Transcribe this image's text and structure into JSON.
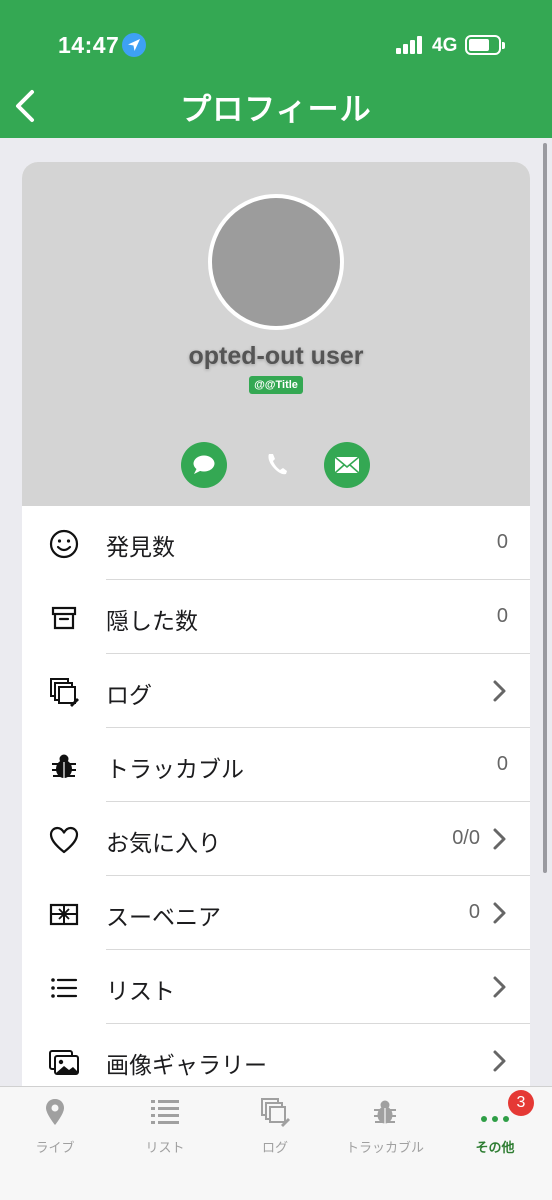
{
  "status_bar": {
    "time": "14:47",
    "network": "4G"
  },
  "header": {
    "title": "プロフィール"
  },
  "profile": {
    "username": "opted-out user",
    "title_badge": "@@Title"
  },
  "rows": [
    {
      "label": "発見数",
      "value": "0",
      "icon": "smiley-icon",
      "chevron": false
    },
    {
      "label": "隠した数",
      "value": "0",
      "icon": "archive-box-icon",
      "chevron": false
    },
    {
      "label": "ログ",
      "value": "",
      "icon": "logs-icon",
      "chevron": true
    },
    {
      "label": "トラッカブル",
      "value": "0",
      "icon": "bug-icon",
      "chevron": false
    },
    {
      "label": "お気に入り",
      "value": "0/0",
      "icon": "heart-icon",
      "chevron": true
    },
    {
      "label": "スーベニア",
      "value": "0",
      "icon": "gift-box-icon",
      "chevron": true
    },
    {
      "label": "リスト",
      "value": "",
      "icon": "list-icon",
      "chevron": true
    },
    {
      "label": "画像ギャラリー",
      "value": "",
      "icon": "image-gallery-icon",
      "chevron": true
    }
  ],
  "tabs": [
    {
      "label": "ライブ",
      "icon": "map-pin-icon"
    },
    {
      "label": "リスト",
      "icon": "list-icon"
    },
    {
      "label": "ログ",
      "icon": "logs-icon"
    },
    {
      "label": "トラッカブル",
      "icon": "bug-icon"
    },
    {
      "label": "その他",
      "icon": "more-dots-icon",
      "badge": "3"
    }
  ],
  "colors": {
    "brand_green": "#34a853",
    "badge_red": "#e53935"
  }
}
